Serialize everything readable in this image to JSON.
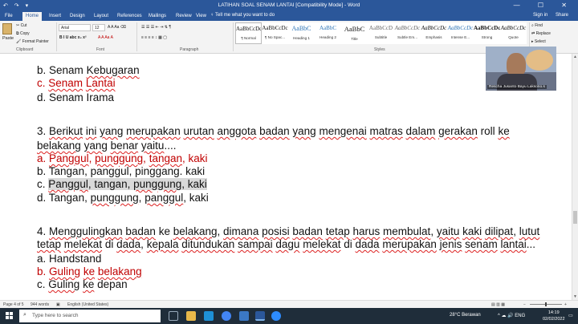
{
  "titlebar": {
    "title": "LATIHAN SOAL SENAM LANTAI [Compatibility Mode] - Word",
    "qat": "↶ ↷ ▾",
    "window_controls": "—  ☐  ✕"
  },
  "tabs": [
    "File",
    "Home",
    "Insert",
    "Design",
    "Layout",
    "References",
    "Mailings",
    "Review",
    "View"
  ],
  "tell_me": "♀ Tell me what you want to do",
  "sign_in": "Sign in",
  "share": "Share",
  "clipboard": {
    "paste": "Paste",
    "cut": "Cut",
    "copy": "Copy",
    "format_painter": "Format Painter",
    "label": "Clipboard"
  },
  "font": {
    "family": "Arial",
    "size": "12",
    "label": "Font",
    "format_row": "B  I  U  abc  x₂  x²",
    "color_row": "A  A  Aa  A"
  },
  "paragraph": {
    "label": "Paragraph",
    "row1": "☰  ☰  ☰  ⇤  ⇥  ⇅  ¶",
    "row2": "≡  ≡  ≡  ≡  ↕  ▦  ▢"
  },
  "styles": {
    "label": "Styles",
    "items": [
      {
        "preview": "AaBbCcDc",
        "name": "¶ Normal"
      },
      {
        "preview": "AaBbCcDc",
        "name": "¶ No Spac..."
      },
      {
        "preview": "AaBbC",
        "name": "Heading 1"
      },
      {
        "preview": "AaBbC",
        "name": "Heading 2"
      },
      {
        "preview": "AaBbC",
        "name": "Title"
      },
      {
        "preview": "AaBbCcD",
        "name": "Subtitle"
      },
      {
        "preview": "AaBbCcDc",
        "name": "Subtle Em..."
      },
      {
        "preview": "AaBbCcDc",
        "name": "Emphasis"
      },
      {
        "preview": "AaBbCcDc",
        "name": "Intense E..."
      },
      {
        "preview": "AaBbCcDc",
        "name": "Strong"
      },
      {
        "preview": "AaBbCcDc",
        "name": "Quote"
      }
    ]
  },
  "editing": {
    "find": "Find",
    "replace": "Replace",
    "select": "Select"
  },
  "document": {
    "q2_b": {
      "letter": "b.",
      "text": "Senam",
      "word": "Kebugaran"
    },
    "q2_c": {
      "letter": "c.",
      "text": "Senam",
      "word": "Lantai"
    },
    "q2_d": {
      "letter": "d.",
      "text": "Senam Irama"
    },
    "q3_line1": {
      "num": "3.",
      "w1": "Berikut",
      "w2": "ini",
      "w3": "yang",
      "w4": "merupakan",
      "w5": "urutan",
      "w6": "anggota",
      "w7": "badan",
      "w8": "yang",
      "w9": "mengenai",
      "w10": "matras",
      "w11": "dalam",
      "w12": "gerakan",
      "w13": "roll",
      "w14": "ke"
    },
    "q3_line2": {
      "w1": "belakang",
      "w2": "yang",
      "w3": "benar",
      "w4": "yaitu",
      "dots": "...."
    },
    "q3_a": {
      "letter": "a.",
      "w1": "Panggul",
      "w2": "punggung",
      "w3": "tangan",
      "w4": "kaki"
    },
    "q3_b": {
      "letter": "b.",
      "text": "Tangan, panggul, pinggang. kaki"
    },
    "q3_c": {
      "letter": "c.",
      "w1": "Panggul",
      "w2": "tangan",
      "w3": "punggung",
      "w4": "kaki"
    },
    "q3_d": {
      "letter": "d.",
      "w1": "Tangan",
      "w2": "punggung",
      "w3": "panggul",
      "w4": "kaki"
    },
    "q4_line1": {
      "num": "4.",
      "w1": "Menggulingkan",
      "w2": "badan",
      "w3": "ke",
      "w4": "belakang",
      "w5": "dimana",
      "w6": "posisi",
      "w7": "badan",
      "w8": "tetap",
      "w9": "harus",
      "w10": "membulat",
      "w11": "yaitu",
      "w12": "kaki",
      "w13": "dilipat",
      "w14": "lutut"
    },
    "q4_line2": {
      "w1": "tetap",
      "w2": "melekat",
      "w3": "di",
      "w4": "dada",
      "w5": "kepala",
      "w6": "ditundukan",
      "w7": "sampai",
      "w8": "dagu",
      "w9": "melekat",
      "w10": "di",
      "w11": "dada",
      "w12": "merupakan",
      "w13": "jenis",
      "w14": "senam",
      "w15": "lantai",
      "dots": "..."
    },
    "q4_a": {
      "letter": "a.",
      "text": "Handstand"
    },
    "q4_b": {
      "letter": "b.",
      "w1": "Guling",
      "w2": "ke",
      "w3": "belakang"
    },
    "q4_c": {
      "letter": "c.",
      "w1": "Guling",
      "w2": "ke",
      "w3": "depan"
    }
  },
  "webcam": {
    "name": "Rescha Jusanto Bayu Laksono.s"
  },
  "status": {
    "page": "Page 4 of 5",
    "words": "944 words",
    "lang": "English (United States)",
    "zoom": "+"
  },
  "taskbar": {
    "search_placeholder": "Type here to search",
    "weather": "28°C  Berawan",
    "tray": "^  ☁  🔊  ENG",
    "time": "14:19",
    "date": "02/02/2022"
  },
  "colors": {
    "word_blue": "#2b579a",
    "answer_red": "#c00000",
    "selection_gray": "#d9d9d9"
  }
}
